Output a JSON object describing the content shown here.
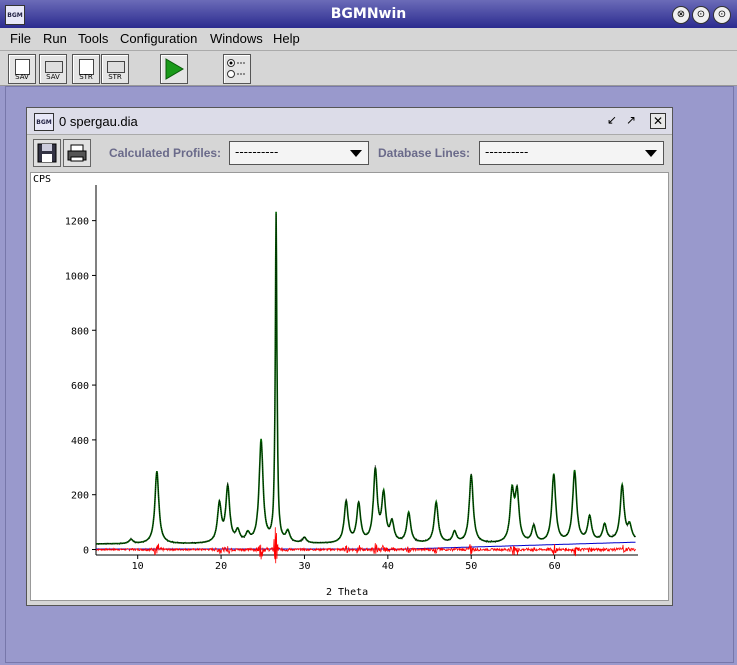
{
  "window": {
    "title": "BGMNwin",
    "app_icon": "BGM",
    "controls": [
      "⊗",
      "⊙",
      "⊙"
    ]
  },
  "menu": [
    "File",
    "Run",
    "Tools",
    "Configuration",
    "Windows",
    "Help"
  ],
  "toolbar": {
    "buttons": [
      {
        "label": "SAV",
        "icon": "save-file-icon"
      },
      {
        "label": "SAV",
        "icon": "save-folder-icon"
      },
      {
        "label": "STR",
        "icon": "structure-file-icon"
      },
      {
        "label": "STR",
        "icon": "structure-folder-icon"
      }
    ],
    "run_icon": "play-icon",
    "options_icon": "radio-options-icon"
  },
  "diagram_window": {
    "title": "0 spergau.dia",
    "calc_label": "Calculated Profiles:",
    "calc_value": "----------",
    "db_label": "Database Lines:",
    "db_value": "----------"
  },
  "chart_data": {
    "type": "line",
    "ylabel": "CPS",
    "xlabel": "2 Theta",
    "xlim": [
      5,
      70
    ],
    "ylim": [
      -20,
      1330
    ],
    "x_ticks": [
      10,
      20,
      30,
      40,
      50,
      60
    ],
    "y_ticks": [
      0,
      200,
      400,
      600,
      800,
      1000,
      1200
    ],
    "colors": {
      "observed": "#000000",
      "calculated": "#006400",
      "difference": "#ff0000",
      "background": "#0000cc"
    },
    "peaks": [
      {
        "x": 9.2,
        "h": 15
      },
      {
        "x": 12.3,
        "h": 265
      },
      {
        "x": 19.8,
        "h": 140
      },
      {
        "x": 20.8,
        "h": 200
      },
      {
        "x": 22.0,
        "h": 40
      },
      {
        "x": 23.2,
        "h": 30
      },
      {
        "x": 24.8,
        "h": 375
      },
      {
        "x": 26.6,
        "h": 1200
      },
      {
        "x": 28.0,
        "h": 40
      },
      {
        "x": 30.0,
        "h": 20
      },
      {
        "x": 35.0,
        "h": 150
      },
      {
        "x": 36.5,
        "h": 140
      },
      {
        "x": 38.5,
        "h": 260
      },
      {
        "x": 39.5,
        "h": 170
      },
      {
        "x": 40.5,
        "h": 70
      },
      {
        "x": 42.5,
        "h": 110
      },
      {
        "x": 45.8,
        "h": 150
      },
      {
        "x": 48.0,
        "h": 40
      },
      {
        "x": 50.0,
        "h": 250
      },
      {
        "x": 54.9,
        "h": 180
      },
      {
        "x": 55.5,
        "h": 175
      },
      {
        "x": 57.5,
        "h": 60
      },
      {
        "x": 59.9,
        "h": 250
      },
      {
        "x": 62.4,
        "h": 260
      },
      {
        "x": 64.2,
        "h": 90
      },
      {
        "x": 66.0,
        "h": 60
      },
      {
        "x": 68.1,
        "h": 200
      },
      {
        "x": 69.0,
        "h": 50
      }
    ],
    "baseline": 20
  }
}
